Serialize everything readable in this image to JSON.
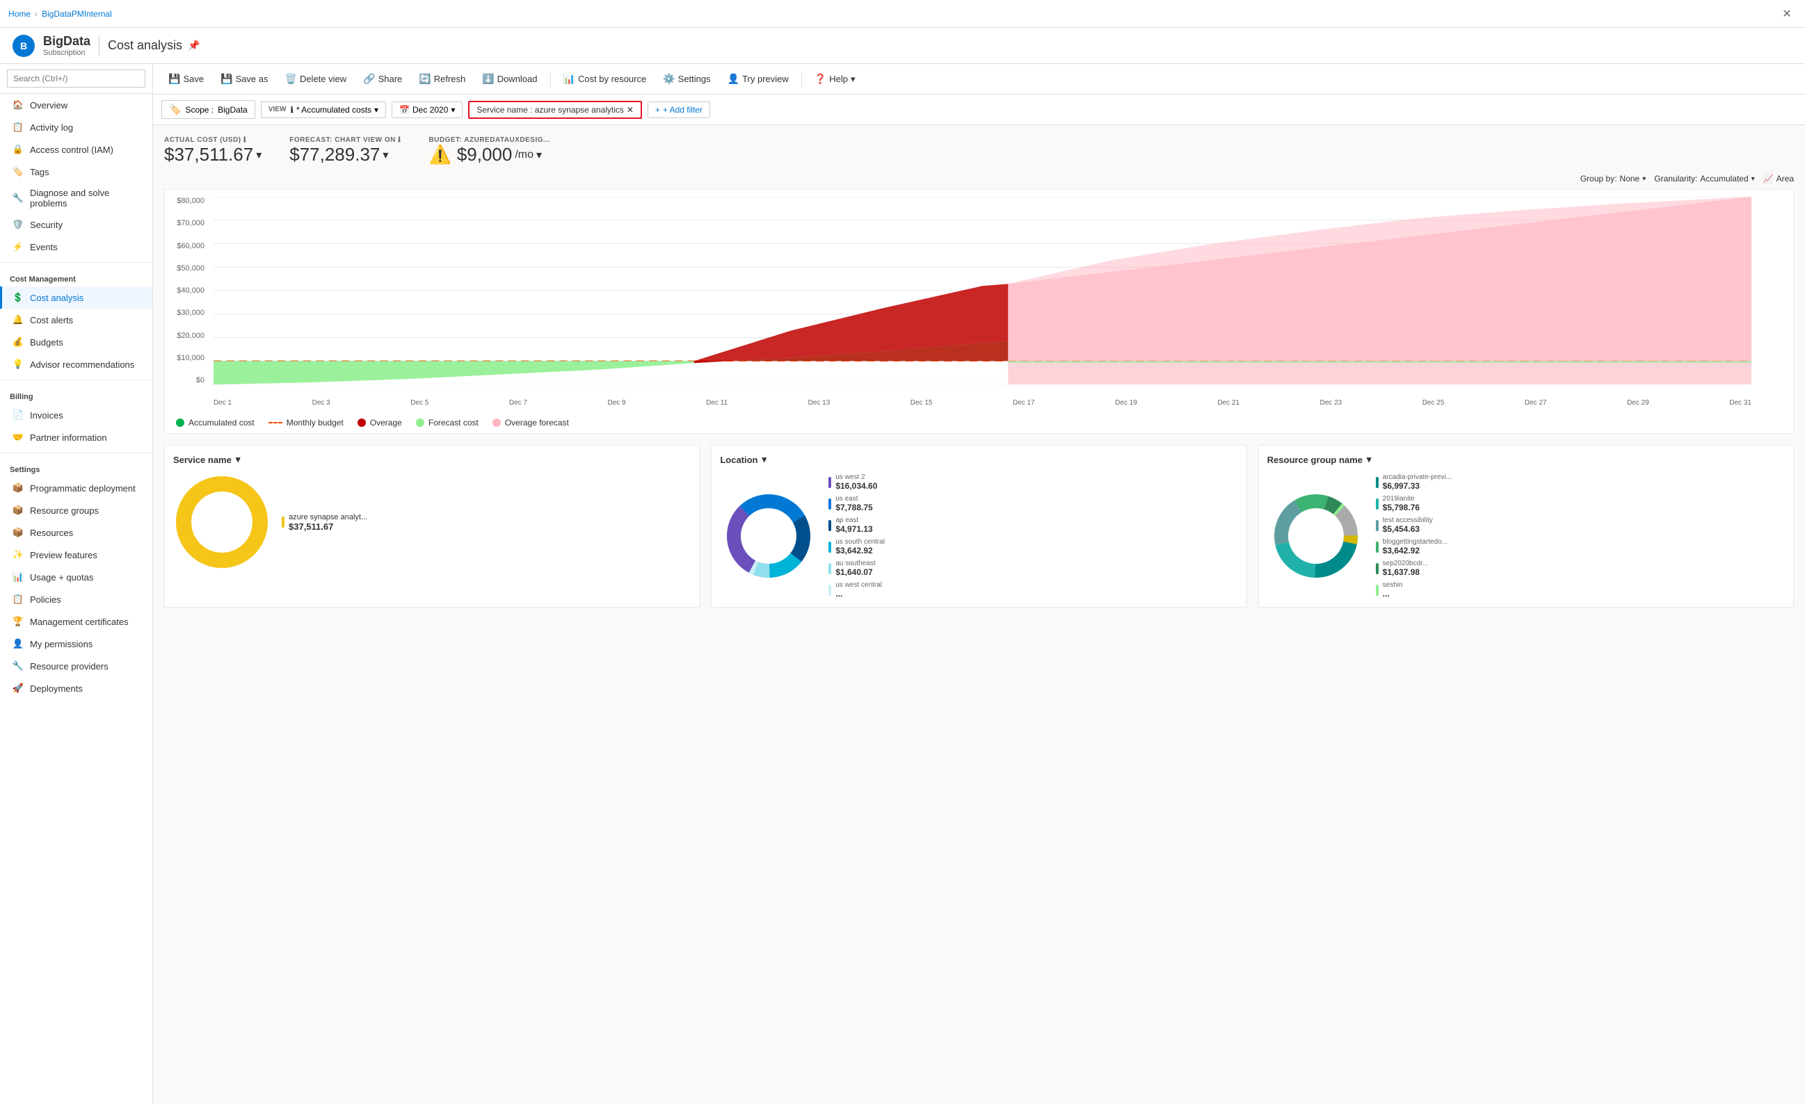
{
  "breadcrumb": {
    "home": "Home",
    "subscription": "BigDataPMInternal"
  },
  "header": {
    "app_name": "BigData",
    "app_subtitle": "Subscription",
    "page_title": "Cost analysis"
  },
  "toolbar": {
    "save": "Save",
    "save_as": "Save as",
    "delete_view": "Delete view",
    "share": "Share",
    "refresh": "Refresh",
    "download": "Download",
    "cost_by_resource": "Cost by resource",
    "settings": "Settings",
    "try_preview": "Try preview",
    "help": "Help"
  },
  "filters": {
    "scope_label": "Scope :",
    "scope_value": "BigData",
    "view_prefix": "VIEW",
    "view_info": "ℹ",
    "view_value": "* Accumulated costs",
    "date_icon": "📅",
    "date_value": "Dec 2020",
    "service_filter_label": "Service name : azure synapse analytics",
    "add_filter": "+ Add filter"
  },
  "cost_summary": {
    "actual_label": "ACTUAL COST (USD)",
    "actual_info": "ℹ",
    "actual_value": "$37,511.67",
    "forecast_label": "FORECAST: CHART VIEW ON",
    "forecast_info": "ℹ",
    "forecast_value": "$77,289.37",
    "budget_label": "BUDGET: AZUREDATAUXDESIG...",
    "budget_value": "$9,000",
    "budget_suffix": "/mo"
  },
  "chart_controls": {
    "group_by_label": "Group by:",
    "group_by_value": "None",
    "granularity_label": "Granularity:",
    "granularity_value": "Accumulated",
    "view_type": "Area"
  },
  "chart": {
    "y_labels": [
      "$80,000",
      "$70,000",
      "$60,000",
      "$50,000",
      "$40,000",
      "$30,000",
      "$20,000",
      "$10,000",
      "$0"
    ],
    "x_labels": [
      "Dec 1",
      "Dec 3",
      "Dec 5",
      "Dec 7",
      "Dec 9",
      "Dec 11",
      "Dec 13",
      "Dec 15",
      "Dec 17",
      "Dec 19",
      "Dec 21",
      "Dec 23",
      "Dec 25",
      "Dec 27",
      "Dec 29",
      "Dec 31"
    ]
  },
  "legend": {
    "items": [
      {
        "label": "Accumulated cost",
        "type": "dot",
        "color": "#00b050"
      },
      {
        "label": "Monthly budget",
        "type": "dashed",
        "color": "#ff4500"
      },
      {
        "label": "Overage",
        "type": "dot",
        "color": "#c00000"
      },
      {
        "label": "Forecast cost",
        "type": "dot",
        "color": "#90ee90"
      },
      {
        "label": "Overage forecast",
        "type": "dot",
        "color": "#ffb6c1"
      }
    ]
  },
  "bottom_charts": {
    "service": {
      "title": "Service name",
      "items": [
        {
          "label": "azure synapse analyt...",
          "value": "$37,511.67",
          "color": "#f5c518"
        }
      ]
    },
    "location": {
      "title": "Location",
      "items": [
        {
          "label": "us west 2",
          "value": "$16,034.60",
          "color": "#6b4fbb"
        },
        {
          "label": "us east",
          "value": "$7,788.75",
          "color": "#0078d4"
        },
        {
          "label": "ap east",
          "value": "$4,971.13",
          "color": "#004e8c"
        },
        {
          "label": "us south central",
          "value": "$3,642.92",
          "color": "#00b4d8"
        },
        {
          "label": "au southeast",
          "value": "$1,640.07",
          "color": "#90e0ef"
        },
        {
          "label": "us west central",
          "value": "...",
          "color": "#caf0f8"
        }
      ]
    },
    "resource_group": {
      "title": "Resource group name",
      "items": [
        {
          "label": "arcadia-private-previ...",
          "value": "$6,997.33",
          "color": "#008b8b"
        },
        {
          "label": "2019ianite",
          "value": "$5,798.76",
          "color": "#20b2aa"
        },
        {
          "label": "test accessibility",
          "value": "$5,454.63",
          "color": "#5f9ea0"
        },
        {
          "label": "bloggettingstartedo...",
          "value": "$3,642.92",
          "color": "#3cb371"
        },
        {
          "label": "sep2020bcdr...",
          "value": "$1,637.98",
          "color": "#2e8b57"
        },
        {
          "label": "seshin",
          "value": "...",
          "color": "#90ee90"
        }
      ]
    }
  },
  "sidebar": {
    "search_placeholder": "Search (Ctrl+/)",
    "items": [
      {
        "label": "Overview",
        "icon": "🏠",
        "section": "",
        "active": false
      },
      {
        "label": "Activity log",
        "icon": "📋",
        "section": "",
        "active": false
      },
      {
        "label": "Access control (IAM)",
        "icon": "🔒",
        "section": "",
        "active": false
      },
      {
        "label": "Tags",
        "icon": "🏷️",
        "section": "",
        "active": false
      },
      {
        "label": "Diagnose and solve problems",
        "icon": "🔧",
        "section": "",
        "active": false
      },
      {
        "label": "Security",
        "icon": "🛡️",
        "section": "",
        "active": false
      },
      {
        "label": "Events",
        "icon": "⚡",
        "section": "",
        "active": false
      },
      {
        "label": "Cost analysis",
        "icon": "$",
        "section": "Cost Management",
        "active": true
      },
      {
        "label": "Cost alerts",
        "icon": "$",
        "section": "",
        "active": false
      },
      {
        "label": "Budgets",
        "icon": "$",
        "section": "",
        "active": false
      },
      {
        "label": "Advisor recommendations",
        "icon": "$",
        "section": "",
        "active": false
      },
      {
        "label": "Invoices",
        "icon": "📄",
        "section": "Billing",
        "active": false
      },
      {
        "label": "Partner information",
        "icon": "👥",
        "section": "",
        "active": false
      },
      {
        "label": "Programmatic deployment",
        "icon": "📦",
        "section": "Settings",
        "active": false
      },
      {
        "label": "Resource groups",
        "icon": "📦",
        "section": "",
        "active": false
      },
      {
        "label": "Resources",
        "icon": "📦",
        "section": "",
        "active": false
      },
      {
        "label": "Preview features",
        "icon": "📦",
        "section": "",
        "active": false
      },
      {
        "label": "Usage + quotas",
        "icon": "📊",
        "section": "",
        "active": false
      },
      {
        "label": "Policies",
        "icon": "📄",
        "section": "",
        "active": false
      },
      {
        "label": "Management certificates",
        "icon": "🏆",
        "section": "",
        "active": false
      },
      {
        "label": "My permissions",
        "icon": "👤",
        "section": "",
        "active": false
      },
      {
        "label": "Resource providers",
        "icon": "📦",
        "section": "",
        "active": false
      },
      {
        "label": "Deployments",
        "icon": "🚀",
        "section": "",
        "active": false
      }
    ]
  }
}
